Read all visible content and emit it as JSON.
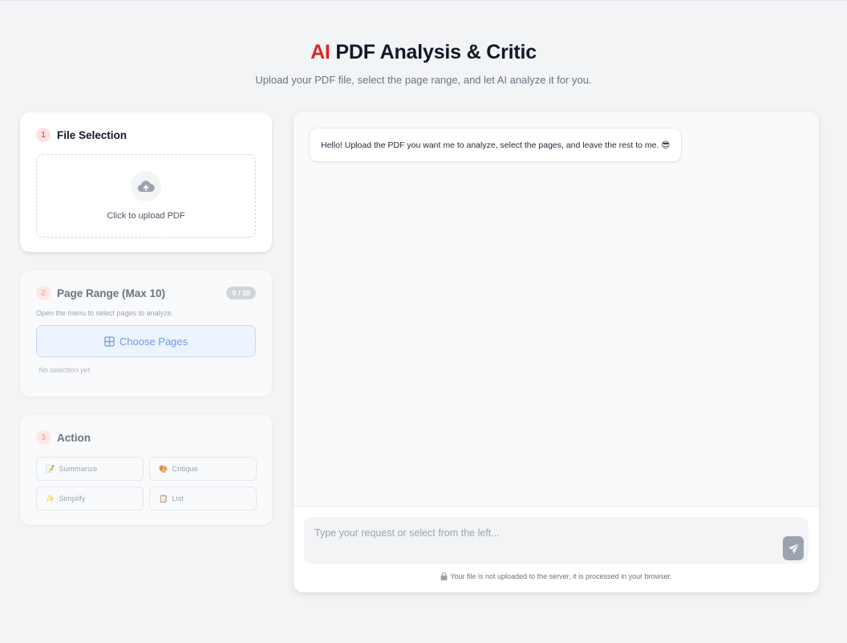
{
  "header": {
    "title_accent": "AI",
    "title_rest": " PDF Analysis & Critic",
    "subtitle": "Upload your PDF file, select the page range, and let AI analyze it for you."
  },
  "file_selection": {
    "step": "1",
    "title": "File Selection",
    "upload_label": "Click to upload PDF",
    "upload_icon": "cloud-upload-icon"
  },
  "page_range": {
    "step": "2",
    "title": "Page Range (Max 10)",
    "counter": "0 / 10",
    "hint": "Open the menu to select pages to analyze.",
    "choose_label": "Choose Pages",
    "choose_icon": "grid-icon",
    "no_selection": "No selection yet"
  },
  "action": {
    "step": "3",
    "title": "Action",
    "buttons": [
      {
        "emoji": "📝",
        "label": "Summarize"
      },
      {
        "emoji": "🎨",
        "label": "Critique"
      },
      {
        "emoji": "✨",
        "label": "Simplify"
      },
      {
        "emoji": "📋",
        "label": "List"
      }
    ]
  },
  "chat": {
    "welcome_message": "Hello! Upload the PDF you want me to analyze, select the pages, and leave the rest to me. 😎",
    "input_placeholder": "Type your request or select from the left...",
    "send_icon": "send-icon",
    "notice": "Your file is not uploaded to the server, it is processed in your browser.",
    "notice_icon": "lock-icon"
  },
  "colors": {
    "accent": "#dc2626",
    "background": "#f3f4f6",
    "choose_button": "#6d9be6"
  }
}
